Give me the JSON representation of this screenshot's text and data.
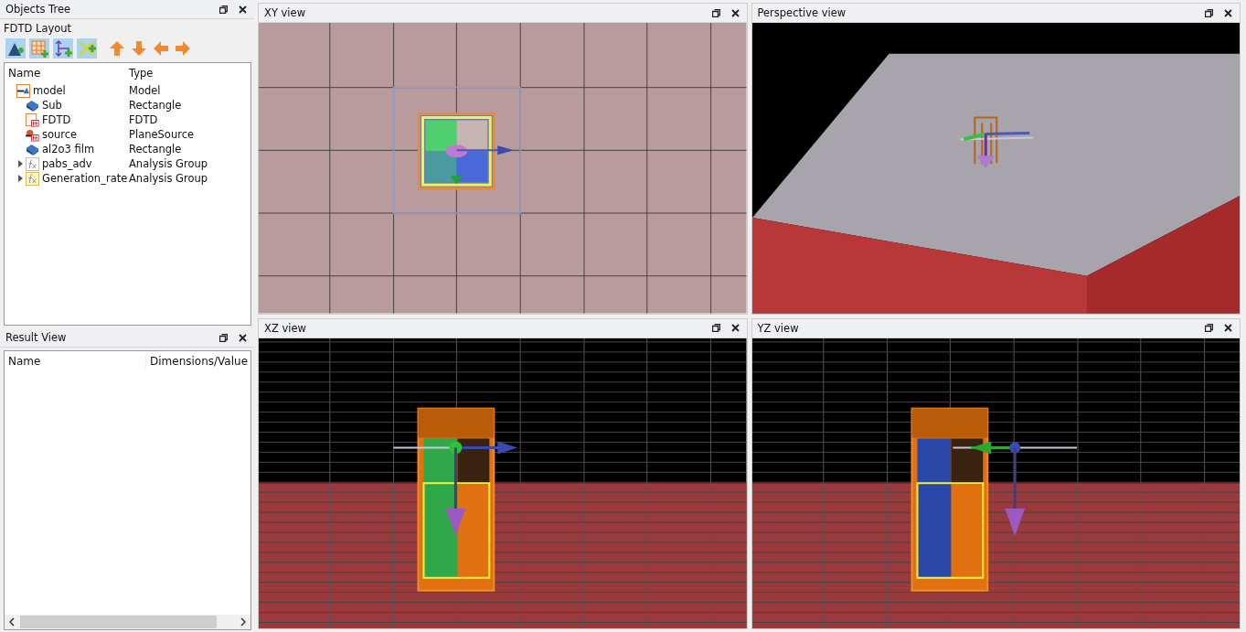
{
  "objects_tree": {
    "title": "Objects Tree",
    "layout_label": "FDTD Layout",
    "columns": [
      "Name",
      "Type"
    ],
    "rows": [
      {
        "name": "model",
        "type": "Model",
        "kind": "model",
        "children": [
          {
            "name": "Sub",
            "type": "Rectangle",
            "kind": "rectangle"
          },
          {
            "name": "FDTD",
            "type": "FDTD",
            "kind": "fdtd"
          },
          {
            "name": "source",
            "type": "PlaneSource",
            "kind": "source"
          },
          {
            "name": "al2o3 film",
            "type": "Rectangle",
            "kind": "rectangle"
          },
          {
            "name": "pabs_adv",
            "type": "Analysis Group",
            "kind": "analysis",
            "expanded": false
          },
          {
            "name": "Generation_rate",
            "type": "Analysis Group",
            "kind": "analysis-highlighted",
            "expanded": false
          }
        ]
      }
    ]
  },
  "result_view": {
    "title": "Result View",
    "columns": [
      "Name",
      "Dimensions/Value"
    ]
  },
  "views": [
    {
      "title": "XY view",
      "kind": "xy"
    },
    {
      "title": "Perspective view",
      "kind": "perspective"
    },
    {
      "title": "XZ view",
      "kind": "xz"
    },
    {
      "title": "YZ view",
      "kind": "yz"
    }
  ]
}
